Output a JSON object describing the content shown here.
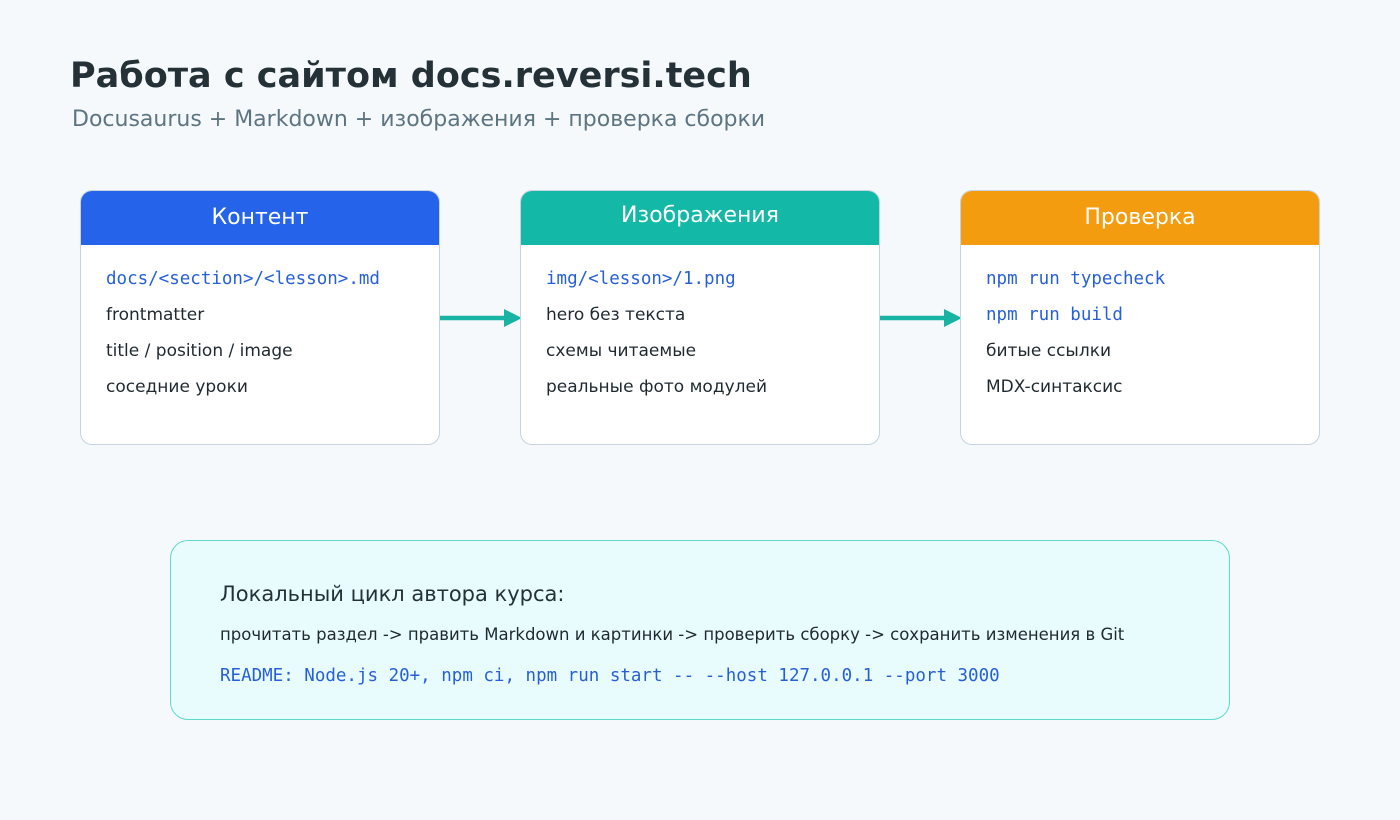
{
  "header": {
    "title": "Работа с сайтом docs.reversi.tech",
    "subtitle": "Docusaurus + Markdown + изображения + проверка сборки"
  },
  "colors": {
    "content": "#2563eb",
    "images": "#14b8a6",
    "check": "#f39c0f",
    "arrow": "#17b4a4",
    "code_text": "#2760d6"
  },
  "cards": [
    {
      "title": "Контент",
      "items": [
        "docs/<section>/<lesson>.md",
        "frontmatter",
        "title / position / image",
        "соседние уроки"
      ]
    },
    {
      "title": "Изображения",
      "items": [
        "img/<lesson>/1.png",
        "hero без текста",
        "схемы читаемые",
        "реальные фото модулей"
      ]
    },
    {
      "title": "Проверка",
      "items": [
        "npm run typecheck",
        "npm run build",
        "битые ссылки",
        "MDX-синтаксис"
      ]
    }
  ],
  "loop": {
    "title": "Локальный цикл автора курса:",
    "flow": "прочитать раздел -> править Markdown и картинки -> проверить сборку -> сохранить изменения в Git",
    "readme": "README: Node.js 20+, npm ci, npm run start -- --host 127.0.0.1 --port 3000"
  }
}
